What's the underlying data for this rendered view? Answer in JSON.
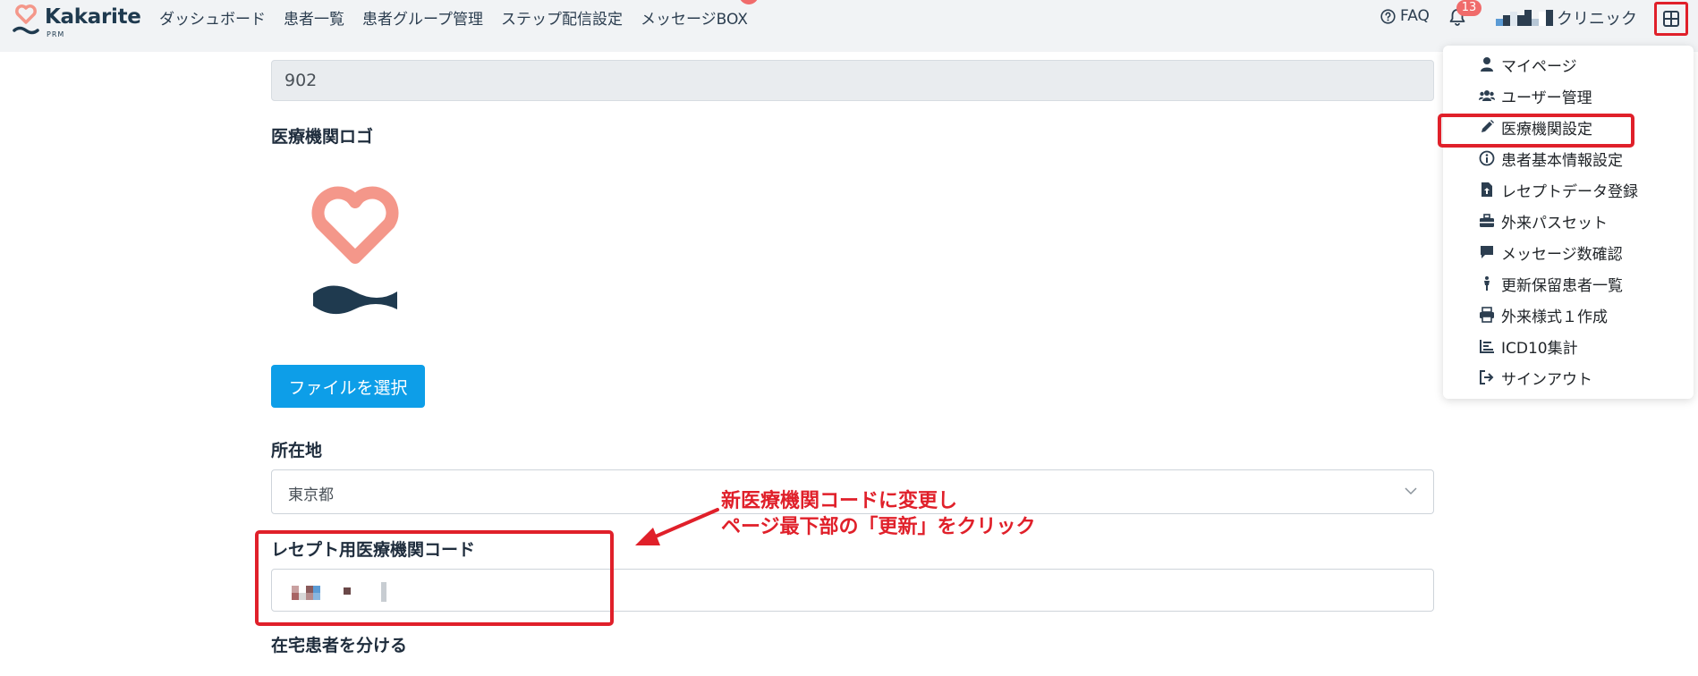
{
  "app": {
    "brand_name": "Kakarite",
    "brand_sub": "PRM"
  },
  "nav": {
    "items": [
      {
        "label": "ダッシュボード"
      },
      {
        "label": "患者一覧"
      },
      {
        "label": "患者グループ管理"
      },
      {
        "label": "ステップ配信設定"
      },
      {
        "label": "メッセージBOX"
      }
    ]
  },
  "header": {
    "faq_label": "FAQ",
    "notification_count": "13",
    "clinic_name": "クリニック"
  },
  "form": {
    "number_value": "902",
    "logo_label": "医療機関ロゴ",
    "file_button_label": "ファイルを選択",
    "location_label": "所在地",
    "location_value": "東京都",
    "receipt_code_label": "レセプト用医療機関コード",
    "home_patient_label": "在宅患者を分ける"
  },
  "annotation": {
    "line1": "新医療機関コードに変更し",
    "line2": "ページ最下部の「更新」をクリック"
  },
  "menu": {
    "items": [
      {
        "label": "マイページ",
        "icon": "user-icon"
      },
      {
        "label": "ユーザー管理",
        "icon": "users-icon"
      },
      {
        "label": "医療機関設定",
        "icon": "pencil-icon"
      },
      {
        "label": "患者基本情報設定",
        "icon": "info-circle-icon"
      },
      {
        "label": "レセプトデータ登録",
        "icon": "file-upload-icon"
      },
      {
        "label": "外来パスセット",
        "icon": "toolbox-icon"
      },
      {
        "label": "メッセージ数確認",
        "icon": "comment-icon"
      },
      {
        "label": "更新保留患者一覧",
        "icon": "person-icon"
      },
      {
        "label": "外来様式１作成",
        "icon": "printer-icon"
      },
      {
        "label": "ICD10集計",
        "icon": "bar-chart-icon"
      },
      {
        "label": "サインアウト",
        "icon": "sign-out-icon"
      }
    ]
  },
  "colors": {
    "accent_red": "#e0202a",
    "primary_blue": "#0d9ee8",
    "logo_coral": "#f4978a",
    "logo_navy": "#1f3a4f"
  }
}
